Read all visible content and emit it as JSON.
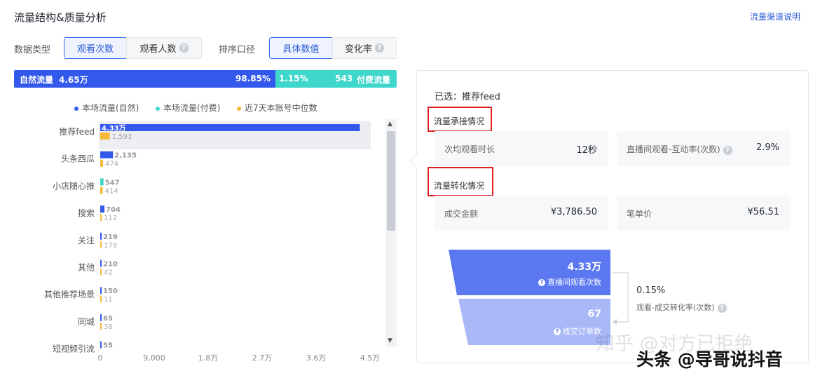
{
  "header": {
    "title": "流量结构&质量分析",
    "channel_link": "流量渠道说明"
  },
  "filters": {
    "data_type_label": "数据类型",
    "data_type_options": [
      "观看次数",
      "观看人数"
    ],
    "data_type_selected": "观看次数",
    "sort_label": "排序口径",
    "sort_options": [
      "具体数值",
      "变化率"
    ],
    "sort_selected": "具体数值"
  },
  "ratio_bar": {
    "natural_label": "自然流量",
    "natural_value": "4.65万",
    "natural_pct_text": "98.85%",
    "natural_pct": 98.85,
    "paid_pct_text": "1.15%",
    "paid_value": "543",
    "paid_label": "付费流量",
    "colors": {
      "natural": "#3358ec",
      "paid": "#3fd6cc"
    }
  },
  "legend": [
    {
      "label": "本场流量(自然)",
      "color": "#3358ec"
    },
    {
      "label": "本场流量(付费)",
      "color": "#3fd6cc"
    },
    {
      "label": "近7天本账号中位数",
      "color": "#f5b93a"
    }
  ],
  "chart_data": {
    "type": "bar",
    "orientation": "horizontal",
    "categories": [
      "推荐feed",
      "头条西瓜",
      "小店随心推",
      "搜索",
      "关注",
      "其他",
      "其他推荐场景",
      "同城",
      "短视频引流"
    ],
    "category_labels": [
      "推荐feed",
      "头条西瓜",
      "小店随心推",
      "搜索",
      "关注",
      "其他",
      "其他推荐场景",
      "同城",
      "短视频引流"
    ],
    "series": [
      {
        "name": "本场流量",
        "values": [
          43300,
          2135,
          547,
          704,
          219,
          210,
          150,
          65,
          55
        ],
        "labels": [
          "4.33万",
          "2,135",
          "547",
          "704",
          "219",
          "210",
          "150",
          "65",
          "55"
        ],
        "colors": [
          "#3358ec",
          "#3358ec",
          "#3fd6cc",
          "#3358ec",
          "#3358ec",
          "#3358ec",
          "#3358ec",
          "#3358ec",
          "#3358ec"
        ]
      },
      {
        "name": "近7天本账号中位数",
        "values": [
          1593,
          474,
          414,
          112,
          179,
          42,
          11,
          38,
          null
        ],
        "labels": [
          "1,593",
          "474",
          "414",
          "112",
          "179",
          "42",
          "11",
          "38",
          ""
        ],
        "color": "#f5b93a"
      }
    ],
    "xticks": [
      "0",
      "9,000",
      "1.8万",
      "2.7万",
      "3.6万",
      "4.5万"
    ],
    "xlim": [
      0,
      45000
    ],
    "highlighted": "推荐feed"
  },
  "panel": {
    "selected_label": "已选：推荐feed",
    "section1_title": "流量承接情况",
    "metrics1": [
      {
        "label": "次均观看时长",
        "value": "12秒"
      },
      {
        "label": "直播间观看-互动率(次数)",
        "value": "2.9%"
      }
    ],
    "section2_title": "流量转化情况",
    "metrics2": [
      {
        "label": "成交金额",
        "value": "¥3,786.50"
      },
      {
        "label": "笔单价",
        "value": "¥56.51"
      }
    ],
    "funnel": {
      "top_value": "4.33万",
      "top_label": "直播间观看次数",
      "bottom_value": "67",
      "bottom_label": "成交订单数",
      "rate": "0.15%",
      "rate_label": "观看-成交转化率(次数)"
    }
  },
  "watermarks": {
    "zhihu": "知乎 @对方已拒绝",
    "toutiao": "头条 @导哥说抖音"
  }
}
